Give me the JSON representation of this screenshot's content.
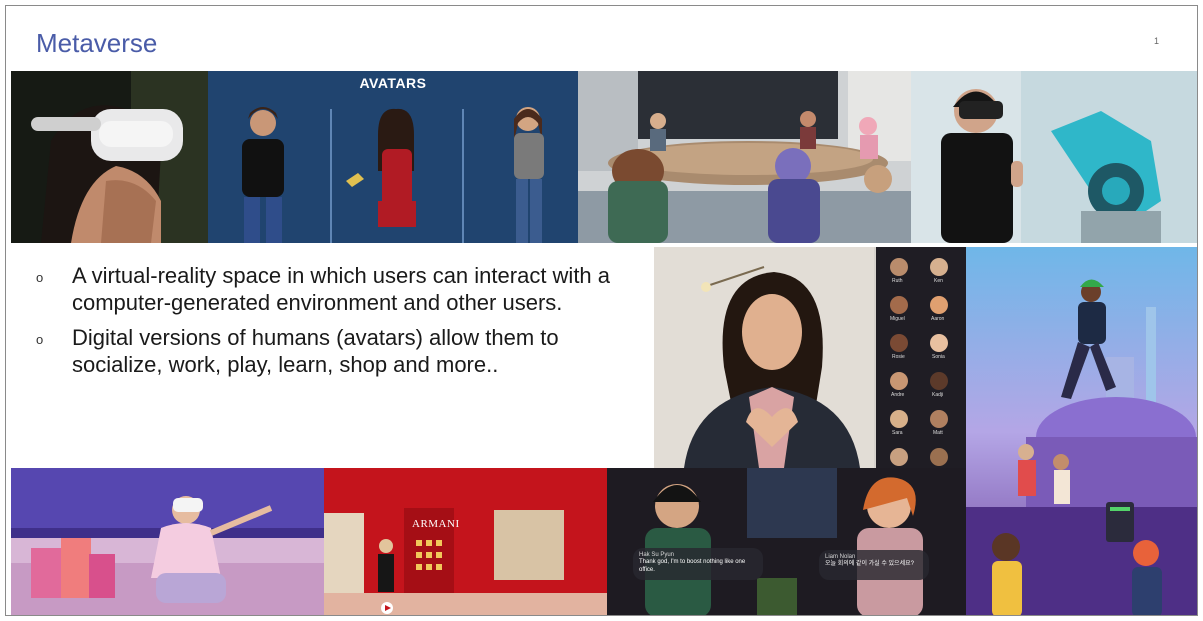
{
  "slide": {
    "title": "Metaverse",
    "page_number": "1",
    "bullets": [
      "A virtual-reality space in which users can interact with a computer-generated environment and other users.",
      "Digital versions of humans (avatars) allow them to socialize, work, play, learn, shop and more.."
    ],
    "bullet_marker": "o"
  },
  "images": {
    "avatars_label": "AVATARS",
    "store_sign": "ARMANI",
    "chat_left": {
      "name": "Hak Su Pyun",
      "text": "Thank god, I'm to boost nothing like one office."
    },
    "chat_right": {
      "name": "Liam Nolan",
      "text": "오늘 회의에 같이 가실 수 있으세요?"
    },
    "participants": [
      "Ruth",
      "Ken",
      "Miguel",
      "Aaron",
      "Rosie",
      "Sonia",
      "Andre",
      "Kadji",
      "Sara",
      "Matt"
    ]
  },
  "colors": {
    "title": "#4a5ca8",
    "text": "#1a1a1a",
    "frame_border": "#8a8a8a"
  }
}
